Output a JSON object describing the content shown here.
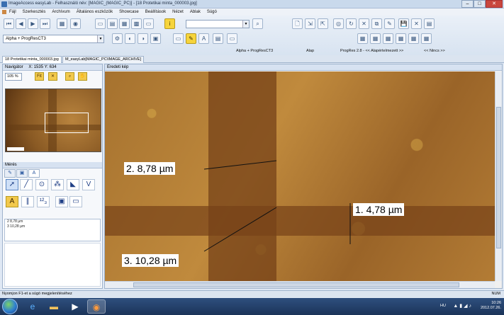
{
  "window": {
    "title": "ImageAccess easyLab - Felhasználó név: [MAGIC_(MAGIC_PC)] - [18 Protetikai minta_000003.jpg]",
    "minimize": "–",
    "maximize": "□",
    "close": "✕"
  },
  "menu": [
    "Fájl",
    "Szerkesztés",
    "Archívum",
    "Általános eszközök",
    "Showcase",
    "Beállítások",
    "Nézet",
    "Ablak",
    "Súgó"
  ],
  "toolbar": {
    "profile_combo": "Alpha + ProgResCT3",
    "status": {
      "profile": "Alpha + ProgResCT3",
      "mode": "Alap",
      "camera": "ProgRes 2.8 - << Alapértelmezett >>",
      "none": "<< Nincs >>"
    }
  },
  "doc_tabs": [
    "18 Protetikai minta_000003.jpg",
    "M_easyLab[MAGIC_PC\\IMAGE_ARCHIVE]"
  ],
  "navigator": {
    "title": "Navigátor",
    "coords": "X: 1535  Y: 634",
    "zoom": "105 %",
    "fit_label": "Fit"
  },
  "measure_panel": {
    "title": "Mérés",
    "items": [
      "2  8,78 µm",
      "3  10,28 µm"
    ]
  },
  "viewport": {
    "title": "Eredeti kép",
    "labels": [
      "2.  8,78 µm",
      "1.  4,78 µm",
      "3.  10,28 µm"
    ]
  },
  "statusbar": {
    "left": "Nyomjon F1-et a súgó megjelenítéséhez",
    "right": "NUM"
  },
  "taskbar": {
    "lang": "HU",
    "time": "10:26",
    "date": "2012.07.26."
  }
}
